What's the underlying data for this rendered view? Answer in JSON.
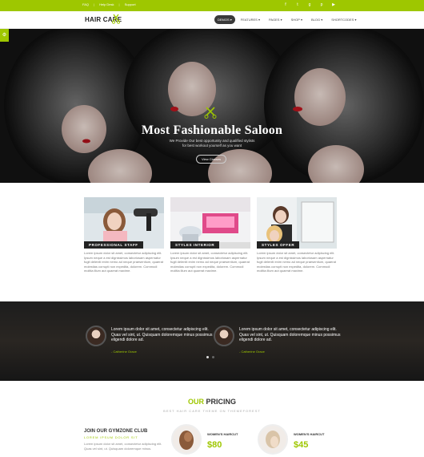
{
  "topbar": {
    "links": [
      "FAQ",
      "Help Desk",
      "Support"
    ],
    "social_icons": [
      "facebook-icon",
      "twitter-icon",
      "google-plus-icon",
      "pinterest-icon",
      "youtube-icon"
    ]
  },
  "header": {
    "logo": "HAIR CARE",
    "nav": [
      {
        "label": "DEMOS ▾",
        "active": true
      },
      {
        "label": "FEATURES ▾",
        "active": false
      },
      {
        "label": "PAGES ▾",
        "active": false
      },
      {
        "label": "SHOP ▾",
        "active": false
      },
      {
        "label": "BLOG ▾",
        "active": false
      },
      {
        "label": "SHORTCODES ▾",
        "active": false
      }
    ]
  },
  "hero": {
    "title": "Most Fashionable Saloon",
    "subtitle_1": "We Provide Our best opportunity and qualified stylists",
    "subtitle_2": "for best workout yourself as you want",
    "button": "View Classes"
  },
  "features": [
    {
      "caption": "PROFESSIONAL STAFF",
      "text": "Lorem ipsum dolor sit amet, consectetur adipiscing elit. Ipsum neque a est dignissimos laboriosam aspernatur fugit deleniti enim nemo ad neque praesentium, quaerat molestias corrupti non expedita, dolorem. Commodi molitia illum aut quaerat maxime."
    },
    {
      "caption": "STYLES INTERIOR",
      "text": "Lorem ipsum dolor sit amet, consectetur adipiscing elit. Ipsum neque a est dignissimos laboriosam aspernatur fugit deleniti enim nemo ad neque praesentium, quaerat molestias corrupti non expedita, dolorem. Commodi molitia illum aut quaerat maxime."
    },
    {
      "caption": "STYLES OFFER",
      "text": "Lorem ipsum dolor sit amet, consectetur adipiscing elit. Ipsum neque a est dignissimos laboriosam aspernatur fugit deleniti enim nemo ad neque praesentium, quaerat molestias corrupti non expedita, dolorem. Commodi molitia illum aut quaerat maxime."
    }
  ],
  "testimonials": [
    {
      "quote": "Lorem ipsum dolor sit amet, consectetur adipiscing elit. Quas vel sint, ut. Quisquam doloremque minus possimus eligendi dolore ad.",
      "author": "- Catherine Grace"
    },
    {
      "quote": "Lorem ipsum dolor sit amet, consectetur adipiscing elit. Quas vel sint, ut. Quisquam doloremque minus possimus eligendi dolore ad.",
      "author": "- Catherine Grace"
    }
  ],
  "pricing": {
    "title_highlight": "OUR",
    "title_rest": " PRICING",
    "subtitle": "BEST HAIR CARE THEME ON THEMEFOREST",
    "club_title": "JOIN OUR GYMZONE CLUB",
    "club_tag": "LOREM IPSUM DOLOR SIT",
    "club_text": "Lorem ipsum dolor sit amet, consectetur adipiscing elit. Quas vel sint, ut. Quisquam doloremque minus.",
    "plans": [
      {
        "name": "WOMEN'S HAIRCUT",
        "price": "$80"
      },
      {
        "name": "WOMEN'S HAIRCUT",
        "price": "$45"
      }
    ]
  },
  "colors": {
    "accent": "#9ec700",
    "dark": "#222222"
  }
}
